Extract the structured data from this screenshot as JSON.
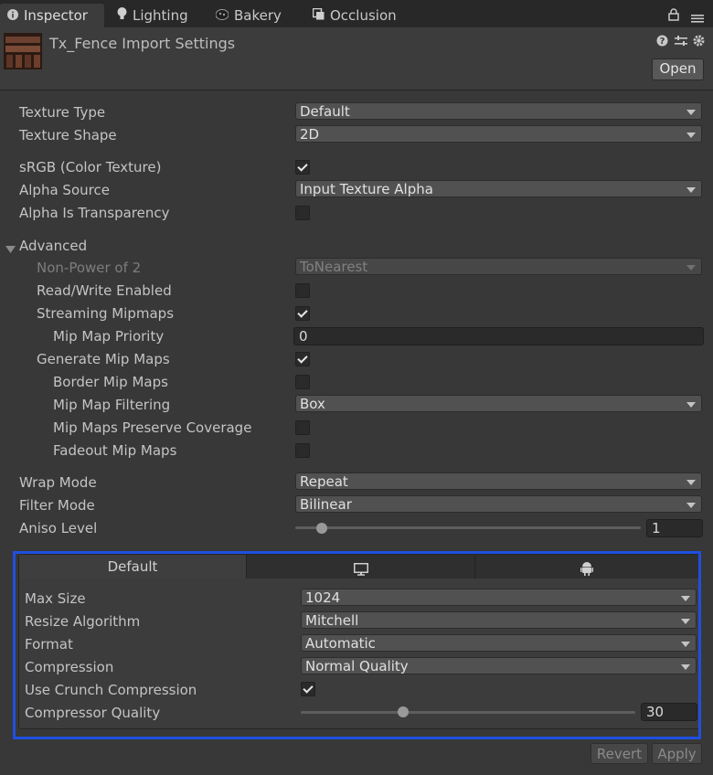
{
  "tabs": [
    {
      "label": "Inspector",
      "icon": "info-icon"
    },
    {
      "label": "Lighting",
      "icon": "bulb-icon"
    },
    {
      "label": "Bakery",
      "icon": "bakery-icon"
    },
    {
      "label": "Occlusion",
      "icon": "occlusion-icon"
    }
  ],
  "header": {
    "title": "Tx_Fence Import Settings",
    "open_label": "Open",
    "icons": [
      "help-icon",
      "presets-icon",
      "gear-icon"
    ]
  },
  "props": {
    "texture_type": {
      "label": "Texture Type",
      "value": "Default"
    },
    "texture_shape": {
      "label": "Texture Shape",
      "value": "2D"
    },
    "srgb": {
      "label": "sRGB (Color Texture)",
      "checked": true
    },
    "alpha_source": {
      "label": "Alpha Source",
      "value": "Input Texture Alpha"
    },
    "alpha_is_transparency": {
      "label": "Alpha Is Transparency",
      "checked": false
    },
    "advanced": {
      "label": "Advanced"
    },
    "non_power_of_2": {
      "label": "Non-Power of 2",
      "value": "ToNearest"
    },
    "read_write": {
      "label": "Read/Write Enabled",
      "checked": false
    },
    "streaming_mipmaps": {
      "label": "Streaming Mipmaps",
      "checked": true
    },
    "mip_map_priority": {
      "label": "Mip Map Priority",
      "value": "0"
    },
    "generate_mip_maps": {
      "label": "Generate Mip Maps",
      "checked": true
    },
    "border_mip_maps": {
      "label": "Border Mip Maps",
      "checked": false
    },
    "mip_map_filtering": {
      "label": "Mip Map Filtering",
      "value": "Box"
    },
    "mip_maps_preserve_coverage": {
      "label": "Mip Maps Preserve Coverage",
      "checked": false
    },
    "fadeout_mip_maps": {
      "label": "Fadeout Mip Maps",
      "checked": false
    },
    "wrap_mode": {
      "label": "Wrap Mode",
      "value": "Repeat"
    },
    "filter_mode": {
      "label": "Filter Mode",
      "value": "Bilinear"
    },
    "aniso_level": {
      "label": "Aniso Level",
      "value": "1"
    }
  },
  "platform": {
    "tabs": [
      {
        "label": "Default"
      },
      {
        "icon": "monitor-icon"
      },
      {
        "icon": "android-icon"
      }
    ],
    "max_size": {
      "label": "Max Size",
      "value": "1024"
    },
    "resize_algorithm": {
      "label": "Resize Algorithm",
      "value": "Mitchell"
    },
    "format": {
      "label": "Format",
      "value": "Automatic"
    },
    "compression": {
      "label": "Compression",
      "value": "Normal Quality"
    },
    "use_crunch": {
      "label": "Use Crunch Compression",
      "checked": true
    },
    "compressor_quality": {
      "label": "Compressor Quality",
      "value": "30"
    }
  },
  "footer": {
    "revert_label": "Revert",
    "apply_label": "Apply"
  },
  "colors": {
    "annotation": "#1f4fe0",
    "background": "#383838"
  }
}
